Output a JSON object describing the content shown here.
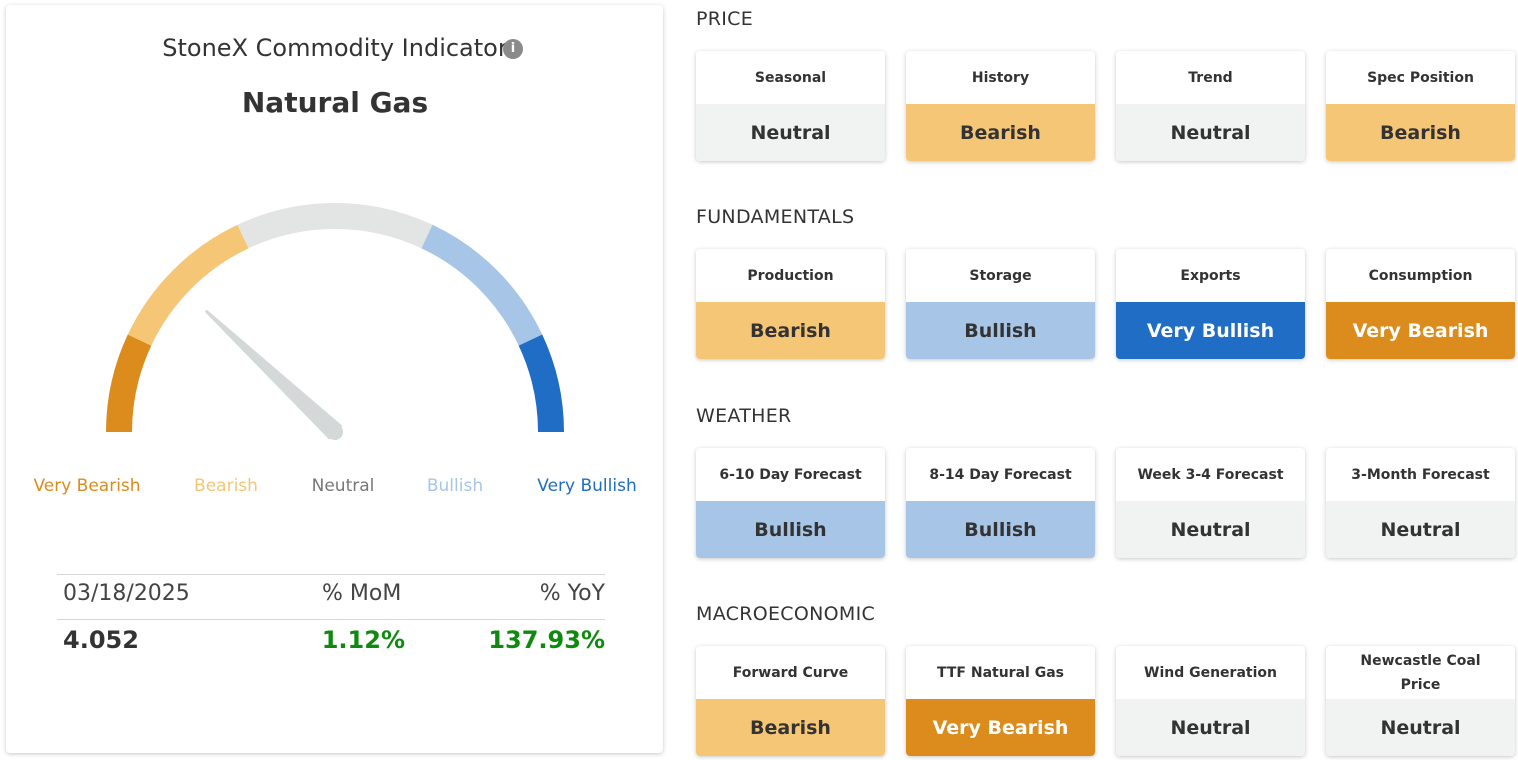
{
  "indicator": {
    "title": "StoneX Commodity Indicator",
    "info_icon": "info-icon",
    "commodity": "Natural Gas",
    "gauge_value_fraction": 0.24,
    "scale_labels": [
      "Very Bearish",
      "Bearish",
      "Neutral",
      "Bullish",
      "Very Bullish"
    ],
    "scale_colors": [
      "#db8c1d",
      "#f6c677",
      "#e3e5e5",
      "#a7c5e7",
      "#1f6dc4"
    ],
    "needle_color": "#d5d8d8"
  },
  "stats": {
    "date": "03/18/2025",
    "mom_label": "% MoM",
    "yoy_label": "% YoY",
    "price": "4.052",
    "mom": "1.12%",
    "yoy": "137.93%",
    "positive_color": "#0f8a0f"
  },
  "sections": [
    {
      "title": "PRICE",
      "items": [
        {
          "label": "Seasonal",
          "value": "Neutral",
          "status": "neutral"
        },
        {
          "label": "History",
          "value": "Bearish",
          "status": "bearish"
        },
        {
          "label": "Trend",
          "value": "Neutral",
          "status": "neutral"
        },
        {
          "label": "Spec Position",
          "value": "Bearish",
          "status": "bearish"
        }
      ]
    },
    {
      "title": "FUNDAMENTALS",
      "items": [
        {
          "label": "Production",
          "value": "Bearish",
          "status": "bearish"
        },
        {
          "label": "Storage",
          "value": "Bullish",
          "status": "bullish"
        },
        {
          "label": "Exports",
          "value": "Very Bullish",
          "status": "verybullish"
        },
        {
          "label": "Consumption",
          "value": "Very Bearish",
          "status": "verybearish"
        }
      ]
    },
    {
      "title": "WEATHER",
      "items": [
        {
          "label": "6-10 Day Forecast",
          "value": "Bullish",
          "status": "bullish"
        },
        {
          "label": "8-14 Day Forecast",
          "value": "Bullish",
          "status": "bullish"
        },
        {
          "label": "Week 3-4 Forecast",
          "value": "Neutral",
          "status": "neutral"
        },
        {
          "label": "3-Month Forecast",
          "value": "Neutral",
          "status": "neutral"
        }
      ]
    },
    {
      "title": "MACROECONOMIC",
      "items": [
        {
          "label": "Forward Curve",
          "value": "Bearish",
          "status": "bearish"
        },
        {
          "label": "TTF Natural Gas",
          "value": "Very Bearish",
          "status": "verybearish"
        },
        {
          "label": "Wind Generation",
          "value": "Neutral",
          "status": "neutral"
        },
        {
          "label": "Newcastle Coal Price",
          "value": "Neutral",
          "status": "neutral"
        }
      ]
    }
  ]
}
